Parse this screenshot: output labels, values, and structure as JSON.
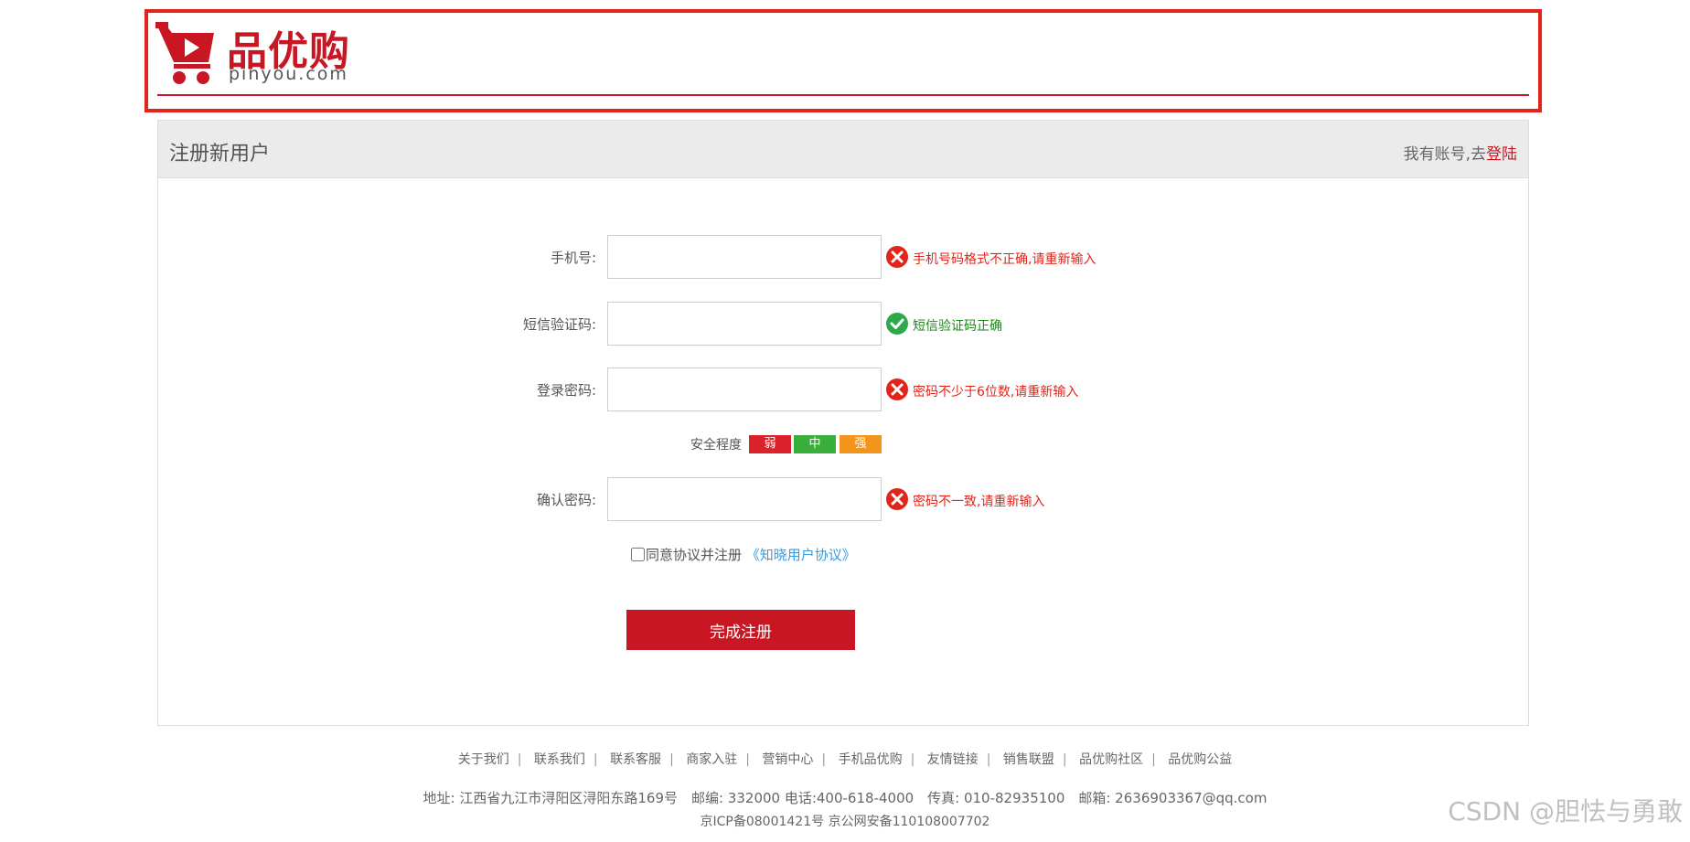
{
  "logo": {
    "name_cn": "品优购",
    "name_en": "pinyou.com"
  },
  "panel": {
    "title": "注册新用户",
    "login_prompt": "我有账号,去",
    "login_link": "登陆"
  },
  "form": {
    "phone": {
      "label": "手机号:",
      "value": "",
      "message": "手机号码格式不正确,请重新输入",
      "status": "error"
    },
    "sms": {
      "label": "短信验证码:",
      "value": "",
      "message": "短信验证码正确",
      "status": "ok"
    },
    "password": {
      "label": "登录密码:",
      "value": "",
      "message": "密码不少于6位数,请重新输入",
      "status": "error"
    },
    "strength": {
      "label": "安全程度",
      "weak": "弱",
      "medium": "中",
      "strong": "强"
    },
    "confirm": {
      "label": "确认密码:",
      "value": "",
      "message": "密码不一致,请重新输入",
      "status": "error"
    },
    "agree": {
      "text": "同意协议并注册",
      "link": "《知晓用户协议》"
    },
    "submit": "完成注册"
  },
  "footer": {
    "links": [
      "关于我们",
      "联系我们",
      "联系客服",
      "商家入驻",
      "营销中心",
      "手机品优购",
      "友情链接",
      "销售联盟",
      "品优购社区",
      "品优购公益"
    ],
    "address": "地址: 江西省九江市浔阳区浔阳东路169号　邮编: 332000 电话:400-618-4000　传真: 010-82935100　邮箱: 2636903367@qq.com",
    "icp": "京ICP备08001421号  京公网安备110108007702"
  },
  "watermark": "CSDN @胆怯与勇敢",
  "colors": {
    "brand_red": "#c81623",
    "error_red": "#e1251b",
    "success_green": "#1a8a1a",
    "weak": "#d9222a",
    "medium": "#3aae3a",
    "strong": "#f3951c",
    "link_blue": "#3a9ad9"
  }
}
